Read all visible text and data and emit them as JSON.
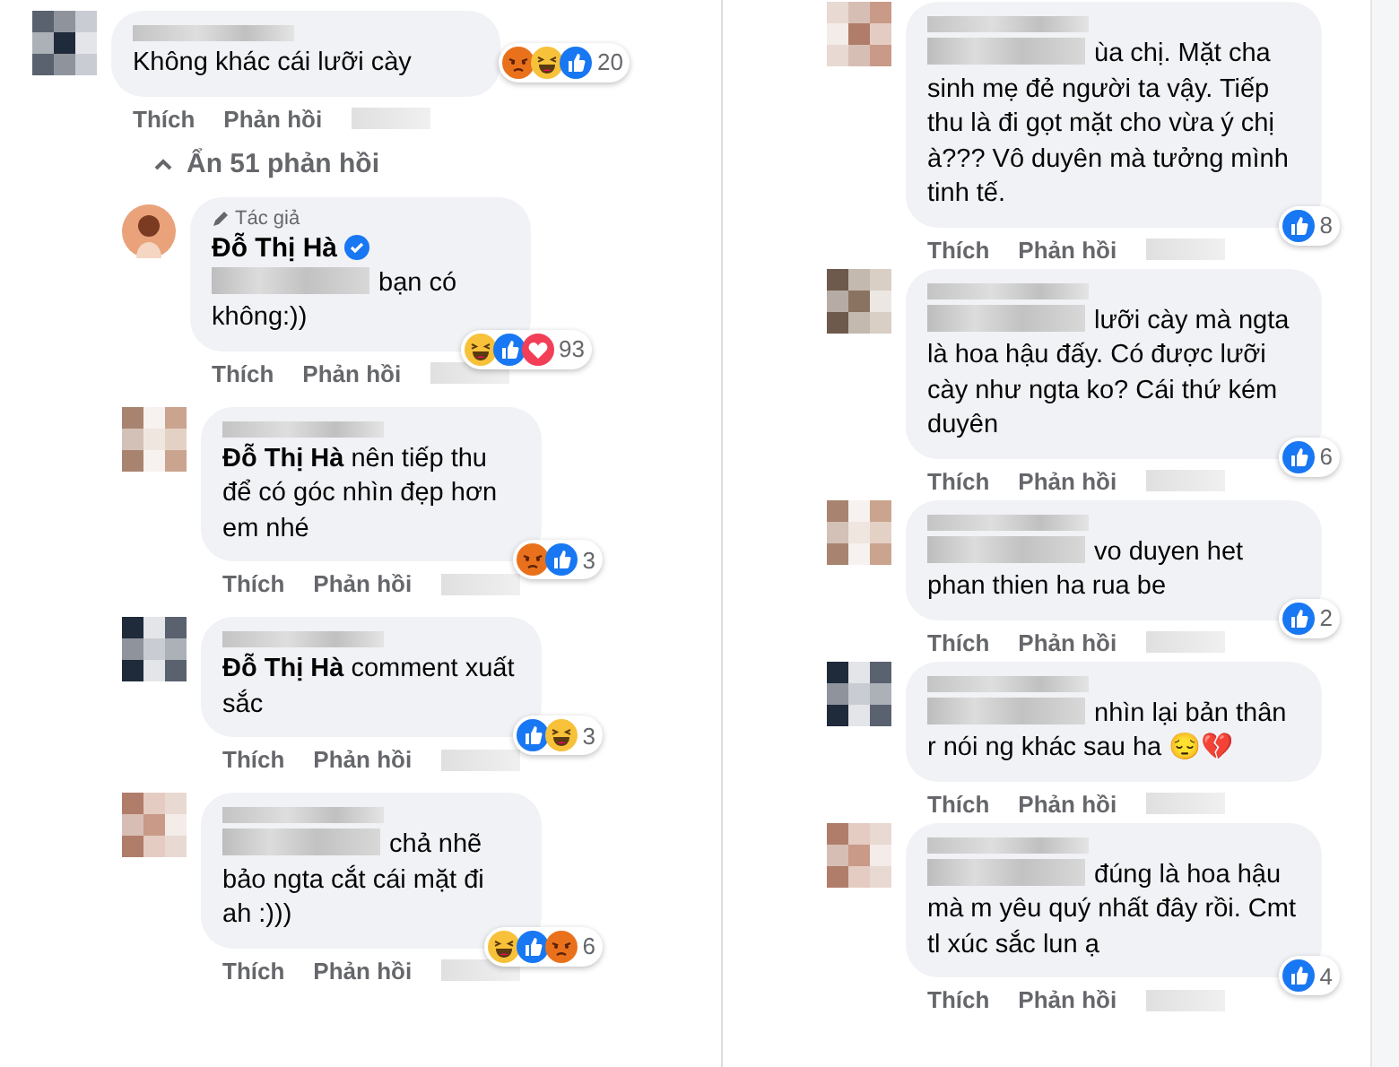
{
  "left_column": {
    "comments": [
      {
        "kind": "comment",
        "name_blurred": true,
        "mention_blurred": false,
        "text": "Không khác cái lưỡi cày",
        "reactions": [
          {
            "kind": "angry"
          },
          {
            "kind": "haha"
          },
          {
            "kind": "like"
          }
        ],
        "reaction_count": "20",
        "actions": [
          "Thích",
          "Phản hồi"
        ]
      },
      {
        "kind": "toggle",
        "label": "Ẩn 51 phản hồi"
      },
      {
        "kind": "reply",
        "author_badge": "Tác giả",
        "name": "Đỗ Thị Hà",
        "verified": true,
        "mention_blurred": true,
        "text": "bạn có không:))",
        "reactions": [
          {
            "kind": "haha"
          },
          {
            "kind": "like"
          },
          {
            "kind": "love"
          }
        ],
        "reaction_count": "93",
        "actions": [
          "Thích",
          "Phản hồi"
        ]
      },
      {
        "kind": "reply",
        "name_blurred": true,
        "mention_blurred": false,
        "text": "**Đỗ Thị Hà** nên tiếp thu để có góc nhìn đẹp hơn em nhé",
        "reactions": [
          {
            "kind": "angry"
          },
          {
            "kind": "like"
          }
        ],
        "reaction_count": "3",
        "actions": [
          "Thích",
          "Phản hồi"
        ]
      },
      {
        "kind": "reply",
        "name_blurred": true,
        "mention_blurred": false,
        "text": "**Đỗ Thị Hà** comment xuất sắc",
        "reactions": [
          {
            "kind": "like"
          },
          {
            "kind": "haha"
          }
        ],
        "reaction_count": "3",
        "actions": [
          "Thích",
          "Phản hồi"
        ]
      },
      {
        "kind": "reply",
        "name_blurred": true,
        "mention_blurred": true,
        "text": "chả nhẽ bảo ngta cắt cái mặt đi ah :)))",
        "reactions": [
          {
            "kind": "haha"
          },
          {
            "kind": "like"
          },
          {
            "kind": "angry"
          }
        ],
        "reaction_count": "6",
        "actions": [
          "Thích",
          "Phản hồi"
        ]
      }
    ]
  },
  "right_column": {
    "comments": [
      {
        "kind": "reply",
        "name_blurred": true,
        "mention_blurred": true,
        "text": "ùa chị. Mặt cha sinh mẹ đẻ người ta vậy. Tiếp thu là đi gọt mặt cho vừa ý chị à??? Vô duyên mà tưởng mình tinh tế.",
        "reactions": [
          {
            "kind": "like"
          }
        ],
        "reaction_count": "8",
        "actions": [
          "Thích",
          "Phản hồi"
        ]
      },
      {
        "kind": "reply",
        "name_blurred": true,
        "mention_blurred": true,
        "text": "lưỡi cày mà ngta là hoa hậu đấy. Có được lưỡi cày như ngta ko? Cái thứ kém duyên",
        "reactions": [
          {
            "kind": "like"
          }
        ],
        "reaction_count": "6",
        "actions": [
          "Thích",
          "Phản hồi"
        ]
      },
      {
        "kind": "reply",
        "name_blurred": true,
        "mention_blurred": true,
        "text": "vo duyen het phan thien ha rua be",
        "reactions": [
          {
            "kind": "like"
          }
        ],
        "reaction_count": "2",
        "actions": [
          "Thích",
          "Phản hồi"
        ]
      },
      {
        "kind": "reply",
        "name_blurred": true,
        "mention_blurred": true,
        "text": "nhìn lại bản thân r nói ng khác sau ha 😔💔",
        "actions": [
          "Thích",
          "Phản hồi"
        ]
      },
      {
        "kind": "reply",
        "name_blurred": true,
        "mention_blurred": true,
        "text": "đúng là hoa hậu mà m yêu quý nhất đây rồi. Cmt tl xúc sắc lun ạ",
        "reactions": [
          {
            "kind": "like"
          }
        ],
        "reaction_count": "4",
        "actions": [
          "Thích",
          "Phản hồi"
        ]
      }
    ]
  }
}
